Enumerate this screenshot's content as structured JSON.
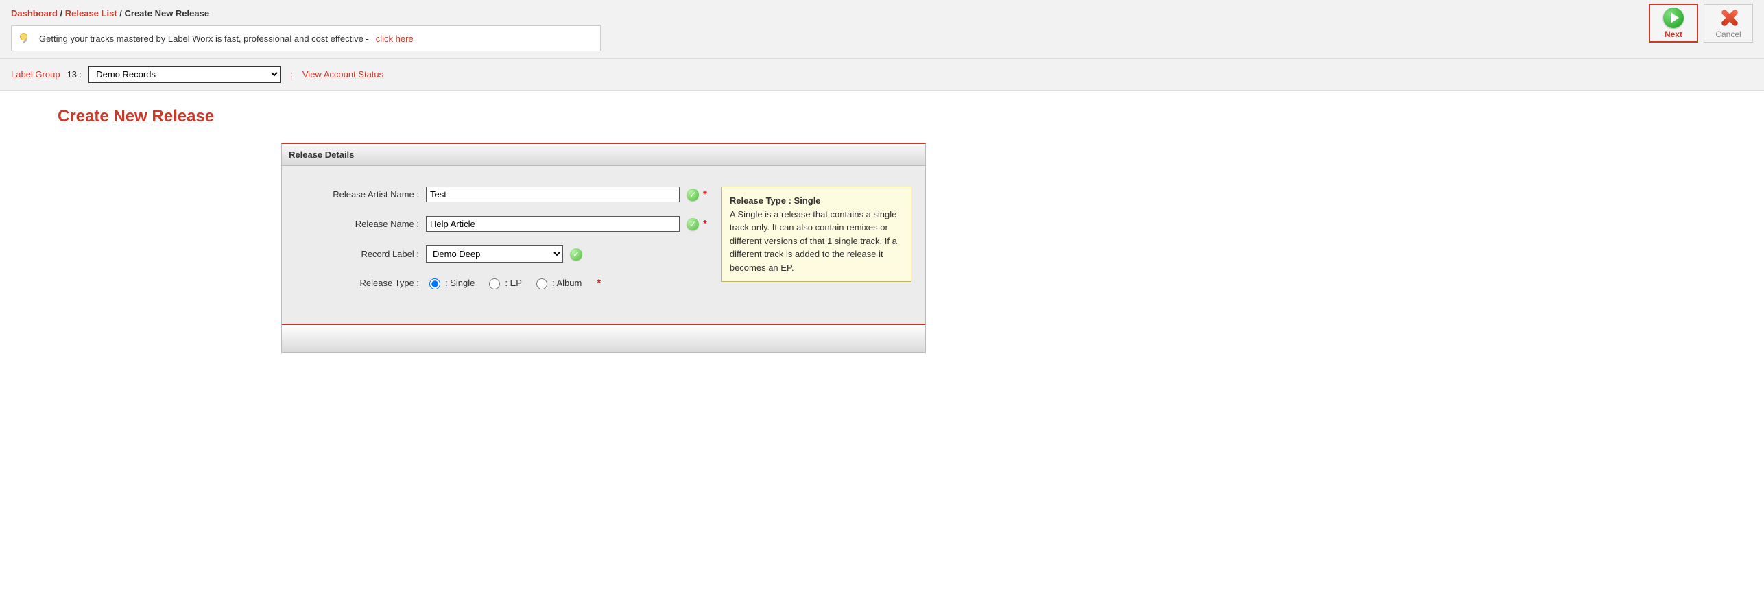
{
  "breadcrumb": {
    "dashboard": "Dashboard",
    "release_list": "Release List",
    "current": "Create New Release"
  },
  "notice": {
    "text": "Getting your tracks mastered by Label Worx is fast, professional and cost effective - ",
    "link": "click here"
  },
  "actions": {
    "next": "Next",
    "cancel": "Cancel"
  },
  "subbar": {
    "label_group": "Label Group",
    "label_group_num": "13 :",
    "selected_label": "Demo Records",
    "view_status": "View Account Status"
  },
  "page_title": "Create New Release",
  "panel": {
    "header": "Release Details",
    "fields": {
      "artist_label": "Release Artist Name :",
      "artist_value": "Test",
      "name_label": "Release Name :",
      "name_value": "Help Article",
      "record_label": "Record Label :",
      "record_value": "Demo Deep",
      "type_label": "Release Type :",
      "type_single": ": Single",
      "type_ep": ": EP",
      "type_album": ": Album"
    },
    "tooltip": {
      "title": "Release Type : Single",
      "body": "A Single is a release that contains a single track only. It can also contain remixes or different versions of that 1 single track. If a different track is added to the release it becomes an EP."
    }
  }
}
